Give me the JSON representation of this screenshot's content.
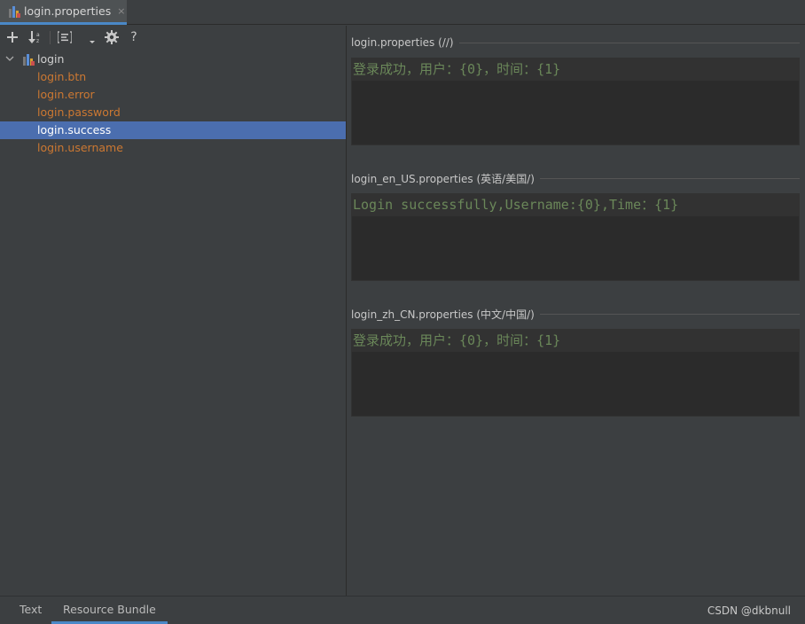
{
  "tab": {
    "title": "login.properties",
    "close": "×"
  },
  "toolbar": {
    "add_icon": "plus-icon",
    "sort_icon": "sort-alpha-icon",
    "group_icon": "group-icon",
    "settings_icon": "gear-icon",
    "help_label": "?"
  },
  "tree": {
    "root_label": "login",
    "items": [
      {
        "label": "login.btn",
        "selected": false
      },
      {
        "label": "login.error",
        "selected": false
      },
      {
        "label": "login.password",
        "selected": false
      },
      {
        "label": "login.success",
        "selected": true
      },
      {
        "label": "login.username",
        "selected": false
      }
    ]
  },
  "sections": [
    {
      "title": "login.properties (//)",
      "value": "登录成功，用户：{0}，时间：{1}"
    },
    {
      "title": "login_en_US.properties (英语/美国/)",
      "value": "Login successfully,Username:{0},Time：{1}"
    },
    {
      "title": "login_zh_CN.properties (中文/中国/)",
      "value": "登录成功，用户：{0}，时间：{1}"
    }
  ],
  "bottom_tabs": [
    {
      "label": "Text",
      "active": false
    },
    {
      "label": "Resource Bundle",
      "active": true
    }
  ],
  "watermark": "CSDN @dkbnull",
  "colors": {
    "key_text": "#cc7832",
    "selection": "#4b6eaf",
    "string_value": "#6a8759",
    "accent": "#4a88c7"
  }
}
